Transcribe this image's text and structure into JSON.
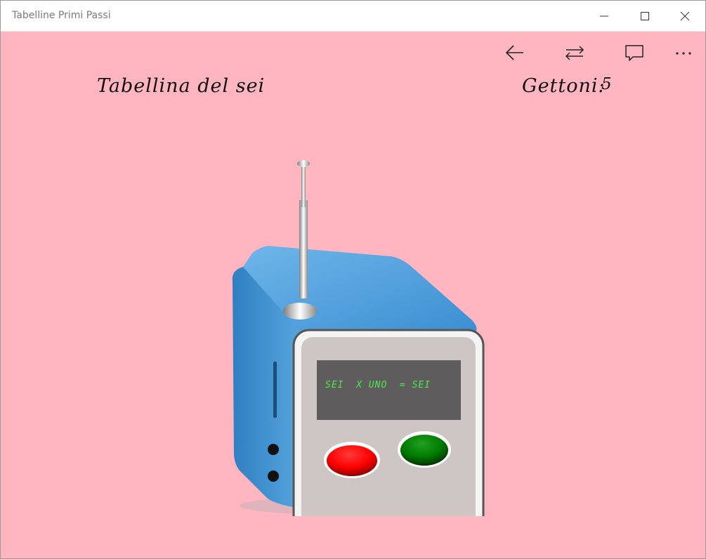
{
  "window": {
    "title": "Tabelline Primi Passi",
    "controls": [
      "minimize-icon",
      "maximize-icon",
      "close-icon"
    ]
  },
  "commandbar": {
    "icons": [
      "back-arrow-icon",
      "switch-arrows-icon",
      "comment-icon",
      "more-icon"
    ]
  },
  "header": {
    "lesson_title": "Tabellina del sei",
    "tokens_label": "Gettoni:",
    "tokens_value": "5"
  },
  "radio": {
    "display_text": "SEI  X UNO  = SEI",
    "buttons": [
      {
        "name": "red-button",
        "color": "#ff0000"
      },
      {
        "name": "green-button",
        "color": "#008000"
      }
    ]
  },
  "colors": {
    "background": "#ffb6c1",
    "radio_blue": "#3a8fd0",
    "faceplate": "#cdc6c4",
    "lcd": "#5e5c5d",
    "lcd_text": "#4fe84f"
  }
}
